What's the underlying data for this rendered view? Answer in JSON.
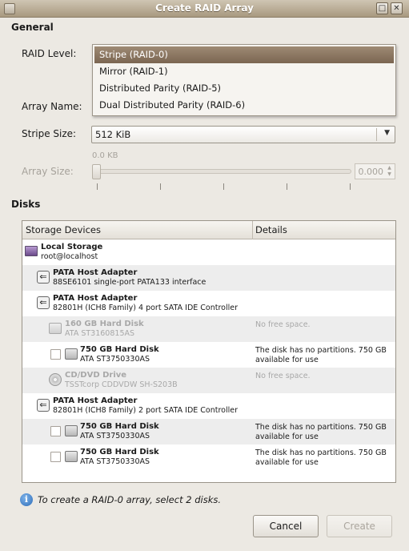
{
  "window": {
    "title": "Create RAID Array"
  },
  "general": {
    "heading": "General",
    "raid_level_label": "RAID Level:",
    "array_name_label": "Array Name:",
    "stripe_size_label": "Stripe Size:",
    "array_size_label": "Array Size:",
    "stripe_size_value": "512 KiB",
    "slider_min_label": "0.0 KB",
    "array_size_value": "0.000",
    "raid_options": [
      "Stripe (RAID-0)",
      "Mirror (RAID-1)",
      "Distributed Parity (RAID-5)",
      "Dual Distributed Parity (RAID-6)"
    ],
    "selected_raid_option": "Stripe (RAID-0)"
  },
  "disks": {
    "heading": "Disks",
    "columns": [
      "Storage Devices",
      "Details"
    ],
    "rows": [
      {
        "title": "Local Storage",
        "subtitle": "root@localhost",
        "details": ""
      },
      {
        "title": "PATA Host Adapter",
        "subtitle": "88SE6101 single-port PATA133 interface",
        "details": ""
      },
      {
        "title": "PATA Host Adapter",
        "subtitle": "82801H (ICH8 Family) 4 port SATA IDE Controller",
        "details": ""
      },
      {
        "title": "160 GB Hard Disk",
        "subtitle": "ATA ST3160815AS",
        "details": "No free space."
      },
      {
        "title": "750 GB Hard Disk",
        "subtitle": "ATA ST3750330AS",
        "details": "The disk has no partitions. 750 GB available for use"
      },
      {
        "title": "CD/DVD Drive",
        "subtitle": "TSSTcorp CDDVDW SH-S203B",
        "details": "No free space."
      },
      {
        "title": "PATA Host Adapter",
        "subtitle": "82801H (ICH8 Family) 2 port SATA IDE Controller",
        "details": ""
      },
      {
        "title": "750 GB Hard Disk",
        "subtitle": "ATA ST3750330AS",
        "details": "The disk has no partitions. 750 GB available for use"
      },
      {
        "title": "750 GB Hard Disk",
        "subtitle": "ATA ST3750330AS",
        "details": "The disk has no partitions. 750 GB available for use"
      }
    ]
  },
  "info": {
    "icon_glyph": "i",
    "text": "To create a RAID-0 array, select 2 disks."
  },
  "buttons": {
    "cancel": "Cancel",
    "create": "Create"
  },
  "colors": {
    "titlebar": "#a8997f",
    "selection": "#7b6652",
    "info_icon": "#2f6db8"
  }
}
